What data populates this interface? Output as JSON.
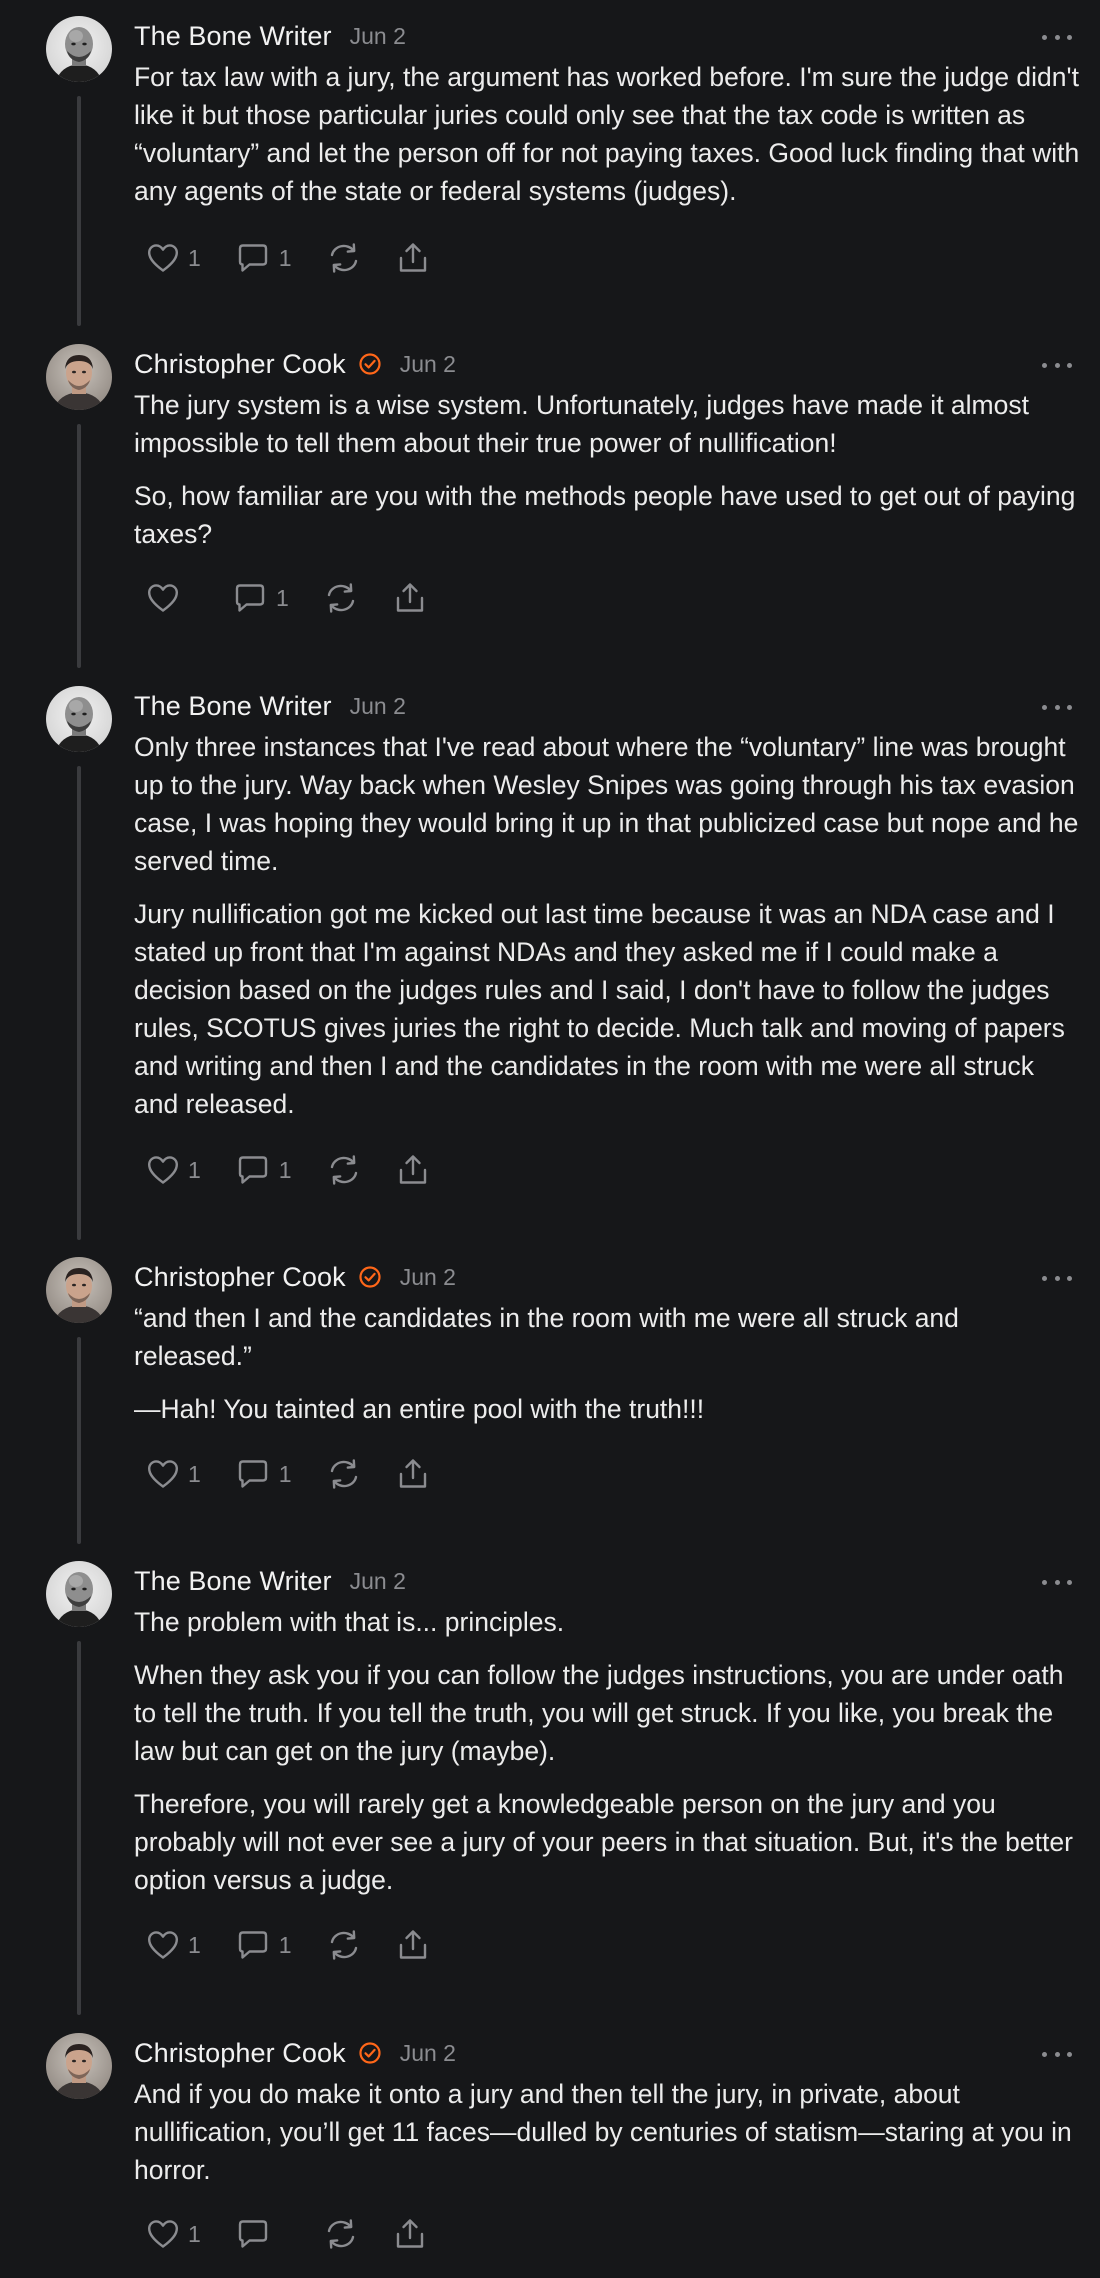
{
  "comments": [
    {
      "author": "The Bone Writer",
      "avatar": "bald-man-bw",
      "verified": false,
      "date": "Jun 2",
      "paragraphs": [
        "For tax law with a jury, the argument has worked before. I'm sure the judge didn't like it but those particular juries could only see that the tax code is written as “voluntary” and let the person off for not paying taxes. Good luck finding that with any agents of the state or federal systems (judges)."
      ],
      "likes": "1",
      "replies": "1"
    },
    {
      "author": "Christopher Cook",
      "avatar": "man-color",
      "verified": true,
      "date": "Jun 2",
      "paragraphs": [
        "The jury system is a wise system. Unfortunately, judges have made it almost impossible to tell them about their true power of nullification!",
        "So, how familiar are you with the methods people have used to get out of paying taxes?"
      ],
      "likes": "",
      "replies": "1"
    },
    {
      "author": "The Bone Writer",
      "avatar": "bald-man-bw",
      "verified": false,
      "date": "Jun 2",
      "paragraphs": [
        "Only three instances that I've read about where the “voluntary” line was brought up to the jury. Way back when Wesley Snipes was going through his tax evasion case, I was hoping they would bring it up in that publicized case but nope and he served time.",
        "Jury nullification got me kicked out last time because it was an NDA case and I stated up front that I'm against NDAs and they asked me if I could make a decision based on the judges rules and I said, I don't have to follow the judges rules, SCOTUS gives juries the right to decide. Much talk and moving of papers and writing and then I and the candidates in the room with me were all struck and released."
      ],
      "likes": "1",
      "replies": "1"
    },
    {
      "author": "Christopher Cook",
      "avatar": "man-color",
      "verified": true,
      "date": "Jun 2",
      "paragraphs": [
        "“and then I and the candidates in the room with me were all struck and released.”",
        "—Hah! You tainted an entire pool with the truth!!!"
      ],
      "likes": "1",
      "replies": "1"
    },
    {
      "author": "The Bone Writer",
      "avatar": "bald-man-bw",
      "verified": false,
      "date": "Jun 2",
      "paragraphs": [
        "The problem with that is... principles.",
        "When they ask you if you can follow the judges instructions, you are under oath to tell the truth. If you tell the truth, you will get struck. If you like, you break the law but can get on the jury (maybe).",
        "Therefore, you will rarely get a knowledgeable person on the jury and you probably will not ever see a jury of your peers in that situation. But, it's the better option versus a judge."
      ],
      "likes": "1",
      "replies": "1"
    },
    {
      "author": "Christopher Cook",
      "avatar": "man-color",
      "verified": true,
      "date": "Jun 2",
      "paragraphs": [
        "And if you do make it onto a jury and then tell the jury, in private, about nullification, you’ll get 11 faces—dulled by centuries of statism—staring at you in horror."
      ],
      "likes": "1",
      "replies": ""
    }
  ],
  "icons": {
    "like": "heart-icon",
    "reply": "comment-icon",
    "restack": "restack-icon",
    "share": "share-icon",
    "more": "more-icon",
    "verified": "verified-check-icon"
  },
  "colors": {
    "background": "#161719",
    "text": "#ececec",
    "muted": "#8b8c90",
    "accent": "#ff6719",
    "thread_line": "#3a3b3e"
  }
}
